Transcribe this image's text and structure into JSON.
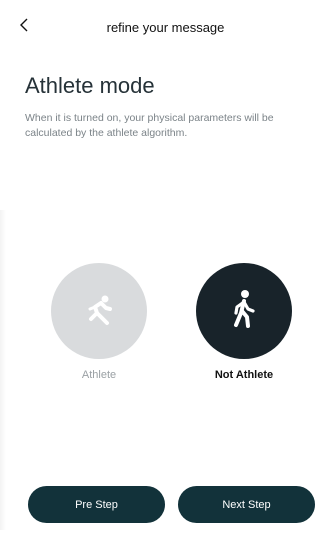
{
  "header": {
    "back_icon": "chevron-left-icon",
    "title": "refine your message"
  },
  "main": {
    "heading": "Athlete mode",
    "description": "When it is turned on, your physical parameters will be calculated by the athlete algorithm."
  },
  "options": [
    {
      "label": "Athlete",
      "icon": "running-person-icon",
      "selected": false
    },
    {
      "label": "Not Athlete",
      "icon": "walking-person-icon",
      "selected": true
    }
  ],
  "footer": {
    "pre_label": "Pre Step",
    "next_label": "Next Step"
  },
  "colors": {
    "active_circle": "#18232a",
    "inactive_circle": "#d9dbdd",
    "button": "#12323a"
  }
}
